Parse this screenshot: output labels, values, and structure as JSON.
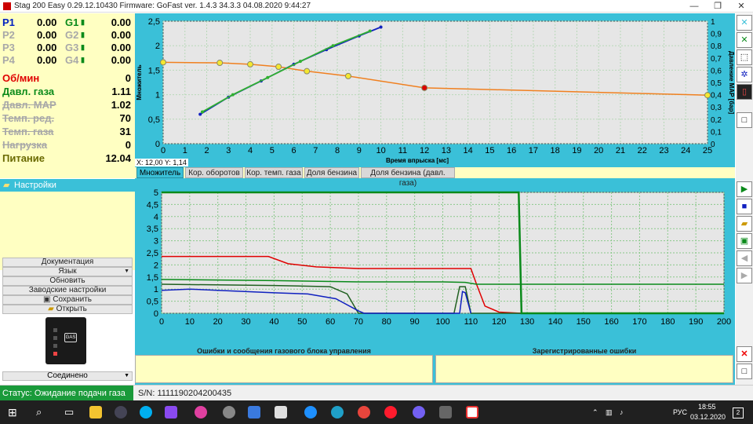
{
  "titlebar": {
    "title": "Stag 200 Easy 0.29.12.10430 Firmware: GoFast  ver. 1.4.3  34.3.3   04.08.2020 9:44:27",
    "minimize": "—",
    "restore": "❐",
    "close": "✕"
  },
  "pg": [
    {
      "p": "P1",
      "p_val": "0.00",
      "g": "G1",
      "g_val": "0.00",
      "active": true
    },
    {
      "p": "P2",
      "p_val": "0.00",
      "g": "G2",
      "g_val": "0.00",
      "active": false
    },
    {
      "p": "P3",
      "p_val": "0.00",
      "g": "G3",
      "g_val": "0.00",
      "active": false
    },
    {
      "p": "P4",
      "p_val": "0.00",
      "g": "G4",
      "g_val": "0.00",
      "active": false
    }
  ],
  "sensors": [
    {
      "label": "Об/мин",
      "value": "0",
      "color": "#e00000",
      "strike": false
    },
    {
      "label": "Давл. газа",
      "value": "1.11",
      "color": "#0a8a1a",
      "strike": false
    },
    {
      "label": "Давл. MAP",
      "value": "1.02",
      "color": "#a8a8a8",
      "strike": true
    },
    {
      "label": "Темп. ред.",
      "value": "70",
      "color": "#a8a8a8",
      "strike": true
    },
    {
      "label": "Темп. газа",
      "value": "31",
      "color": "#a8a8a8",
      "strike": true
    },
    {
      "label": "Нагрузка",
      "value": "0",
      "color": "#a8a8a8",
      "strike": true
    },
    {
      "label": "Питание",
      "value": "12.04",
      "color": "#6a6a00",
      "strike": false
    }
  ],
  "settings_tab": "Настройки",
  "menu": {
    "documentation": "Документация",
    "language": "Язык",
    "update": "Обновить",
    "factory": "Заводские настройки",
    "save": "Сохранить",
    "open": "Открыть",
    "connected": "Соединено"
  },
  "device_label": "GAS",
  "status": {
    "text": "Статус: Ожидание подачи газа",
    "sn": "S/N: 1111190204200435"
  },
  "tabs": [
    "Множитель",
    "Кор. оборотов",
    "Кор. темп. газа",
    "Доля бензина",
    "Доля бензина (давл. газа)"
  ],
  "cursor_readout": "X: 12,00  Y: 1,14",
  "errors": {
    "left_title": "Ошибки и сообщения газового блока управления",
    "right_title": "Зарегистрированные ошибки"
  },
  "taskbar": {
    "lang": "РУС",
    "time": "18:55",
    "date": "03.12.2020",
    "notify": "2"
  },
  "colors": {
    "accent": "#3ac0d8",
    "panel": "#ffffc2",
    "status_green": "#1a9a3a"
  },
  "chart_data": [
    {
      "type": "scatter",
      "title": "",
      "xlabel": "Время впрыска [мс]",
      "ylabel": "Множитель",
      "y2label": "Давление MAP [бар]",
      "xlim": [
        0,
        25
      ],
      "ylim": [
        0,
        2.5
      ],
      "y2lim": [
        0,
        1
      ],
      "x_ticks": [
        "0",
        "1",
        "2",
        "3",
        "4",
        "5",
        "6",
        "7",
        "8",
        "9",
        "10",
        "11",
        "12",
        "13",
        "14",
        "15",
        "16",
        "17",
        "18",
        "19",
        "20",
        "21",
        "22",
        "23",
        "24",
        "25"
      ],
      "y_ticks": [
        "0",
        "0,5",
        "1",
        "1,5",
        "2",
        "2,5"
      ],
      "y2_ticks": [
        "0",
        "0,1",
        "0,2",
        "0,3",
        "0,4",
        "0,5",
        "0,6",
        "0,7",
        "0,8",
        "0,9",
        "1"
      ],
      "series": [
        {
          "color": "#f08020",
          "x": [
            0,
            2.6,
            4,
            5.3,
            6.6,
            8.5,
            12,
            25
          ],
          "y": [
            1.66,
            1.65,
            1.62,
            1.57,
            1.48,
            1.38,
            1.14,
            0.99
          ]
        },
        {
          "color": "#1020c0",
          "x": [
            1.7,
            3,
            4.5,
            6,
            7.5,
            9,
            10
          ],
          "y": [
            0.6,
            0.95,
            1.28,
            1.62,
            1.92,
            2.2,
            2.38
          ]
        },
        {
          "color": "#30b030",
          "x": [
            1.8,
            3.2,
            4.8,
            6.3,
            7.8,
            9.5
          ],
          "y": [
            0.65,
            1.0,
            1.35,
            1.68,
            2.0,
            2.3
          ]
        }
      ]
    },
    {
      "type": "line",
      "title": "",
      "xlim": [
        0,
        200
      ],
      "ylim": [
        0,
        5
      ],
      "x_ticks": [
        "0",
        "10",
        "20",
        "30",
        "40",
        "50",
        "60",
        "70",
        "80",
        "90",
        "100",
        "110",
        "120",
        "130",
        "140",
        "150",
        "160",
        "170",
        "180",
        "190",
        "200"
      ],
      "y_ticks": [
        "0",
        "0,5",
        "1",
        "1,5",
        "2",
        "2,5",
        "3",
        "3,5",
        "4",
        "4,5",
        "5"
      ],
      "series": [
        {
          "color": "#e00000",
          "x": [
            0,
            38,
            45,
            55,
            70,
            110,
            112,
            115,
            120,
            128
          ],
          "y": [
            2.35,
            2.35,
            2.05,
            1.92,
            1.85,
            1.85,
            1.2,
            0.3,
            0.05,
            0.0
          ]
        },
        {
          "color": "#0a8a1a",
          "x": [
            0,
            40,
            70,
            100,
            108,
            112,
            200
          ],
          "y": [
            1.4,
            1.35,
            1.3,
            1.3,
            1.28,
            1.2,
            1.2
          ]
        },
        {
          "color": "#206020",
          "x": [
            0,
            40,
            60,
            66,
            70,
            104,
            106,
            108,
            110,
            200
          ],
          "y": [
            1.2,
            1.15,
            1.1,
            0.8,
            0.0,
            0.0,
            1.1,
            1.1,
            0.0,
            0.0
          ]
        },
        {
          "color": "#1020c0",
          "x": [
            0,
            10,
            40,
            52,
            62,
            70,
            72,
            106,
            107,
            108,
            110
          ],
          "y": [
            0.95,
            1.0,
            0.85,
            0.8,
            0.6,
            0.1,
            0.0,
            0.0,
            0.9,
            0.85,
            0.0
          ]
        },
        {
          "color": "#0a8a1a",
          "x": [
            0,
            127,
            127,
            128,
            200
          ],
          "y": [
            5,
            5,
            5,
            0,
            0
          ]
        }
      ]
    }
  ]
}
